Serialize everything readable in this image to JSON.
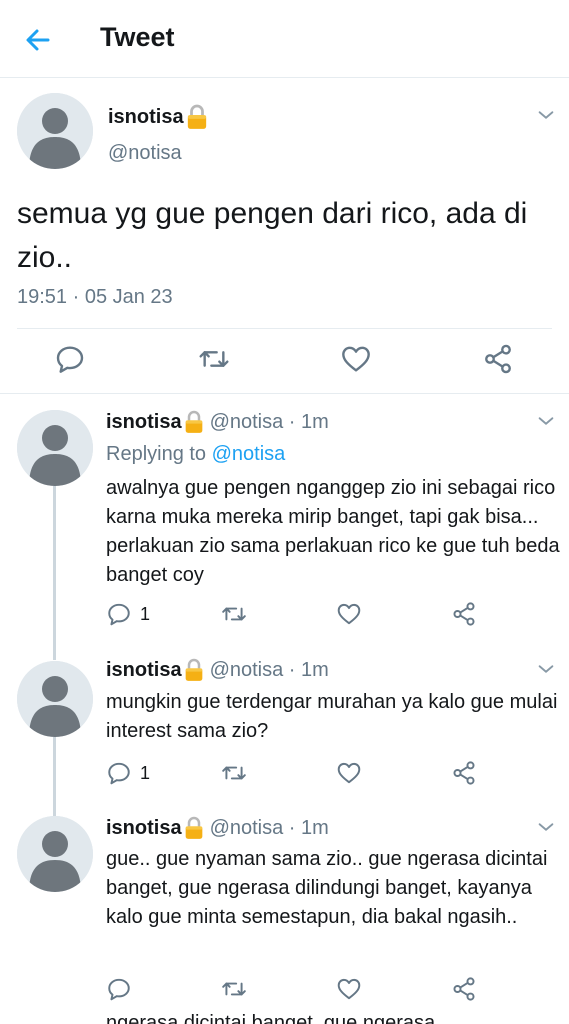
{
  "header": {
    "title": "Tweet"
  },
  "main_tweet": {
    "name": "isnotisa",
    "handle": "@notisa",
    "text": "semua yg gue pengen dari rico, ada di zio..",
    "timestamp": "19:51 · 05 Jan 23"
  },
  "replies": [
    {
      "name": "isnotisa",
      "meta": "@notisa · 1m",
      "replying_prefix": "Replying to ",
      "replying_to": "@notisa",
      "text": "awalnya gue pengen nganggep zio ini sebagai rico karna muka mereka mirip banget, tapi gak bisa... perlakuan zio sama perlakuan rico ke gue tuh beda banget coy",
      "reply_count": "1"
    },
    {
      "name": "isnotisa",
      "meta": "@notisa · 1m",
      "text": "mungkin gue terdengar murahan ya kalo gue mulai interest sama zio?",
      "reply_count": "1"
    },
    {
      "name": "isnotisa",
      "meta": "@notisa · 1m",
      "text": "gue.. gue nyaman sama zio.. gue ngerasa dicintai banget, gue ngerasa dilindungi banget, kayanya kalo gue minta semestapun, dia bakal ngasih..",
      "reply_count": ""
    }
  ],
  "cutoff_text": "ngerasa dicintai banget, gue ngerasa",
  "colors": {
    "accent": "#1da1f2",
    "secondary_text": "#657786",
    "icon": "#657786",
    "divider": "#e6ecf0",
    "avatar_bg": "#e1e8ed",
    "avatar_fg": "#6e767d",
    "lock": "#f5b014"
  },
  "icons": {
    "back": "arrow-left-icon",
    "lock": "lock-icon",
    "menu": "chevron-down-icon",
    "reply": "reply-icon",
    "retweet": "retweet-icon",
    "like": "heart-icon",
    "share": "share-icon"
  }
}
